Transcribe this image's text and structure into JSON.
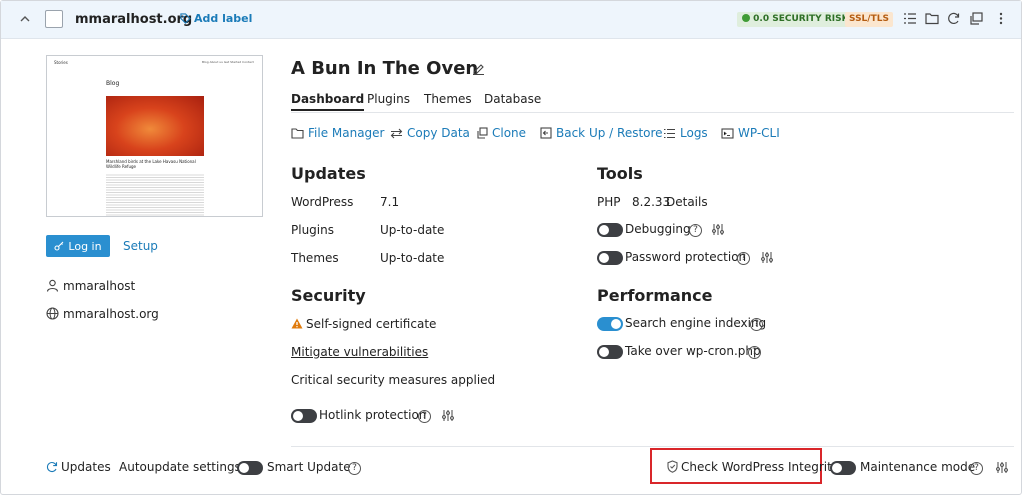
{
  "header": {
    "domain": "mmaralhost.org",
    "add_label": "Add label",
    "security_risk": "0.0 SECURITY RISK",
    "ssl_badge": "SSL/TLS"
  },
  "preview": {
    "site_name": "Stories",
    "nav": "Blog  About us  Get Started  Contact",
    "heading": "Blog",
    "post_title": "Marshland birds at the Lake Havasu National Wildlife Refuge",
    "login": "Log in",
    "setup": "Setup"
  },
  "owner": {
    "user": "mmaralhost",
    "site": "mmaralhost.org"
  },
  "site": {
    "title": "A Bun In The Oven"
  },
  "tabs": [
    {
      "label": "Dashboard"
    },
    {
      "label": "Plugins"
    },
    {
      "label": "Themes"
    },
    {
      "label": "Database"
    }
  ],
  "toolbar": [
    {
      "label": "File Manager"
    },
    {
      "label": "Copy Data"
    },
    {
      "label": "Clone"
    },
    {
      "label": "Back Up / Restore"
    },
    {
      "label": "Logs"
    },
    {
      "label": "WP-CLI"
    }
  ],
  "updates": {
    "title": "Updates",
    "rows": [
      {
        "name": "WordPress",
        "value": "7.1"
      },
      {
        "name": "Plugins",
        "value": "Up-to-date"
      },
      {
        "name": "Themes",
        "value": "Up-to-date"
      }
    ]
  },
  "security": {
    "title": "Security",
    "warning": "Self-signed certificate",
    "mitigate": "Mitigate vulnerabilities",
    "measures": "Critical security measures applied",
    "hotlink": "Hotlink protection"
  },
  "tools": {
    "title": "Tools",
    "php_label": "PHP",
    "php_version": "8.2.33",
    "php_details": "Details",
    "debugging": "Debugging",
    "password": "Password protection"
  },
  "performance": {
    "title": "Performance",
    "indexing": "Search engine indexing",
    "cron": "Take over wp-cron.php"
  },
  "footer": {
    "updates": "Updates",
    "autoupdate": "Autoupdate settings",
    "smart_update": "Smart Update",
    "integrity": "Check WordPress Integrity",
    "maintenance": "Maintenance mode"
  },
  "colors": {
    "accent": "#1b7bb8",
    "highlight_box": "#d9262a",
    "risk_green": "#3f9c35",
    "ssl_orange": "#d67a1e"
  },
  "icons": [
    "chevron-up-icon",
    "tag-icon",
    "list-icon",
    "folder-icon",
    "refresh-icon",
    "copy-icon",
    "more-icon",
    "login-icon",
    "user-icon",
    "globe-icon",
    "pencil-icon",
    "folder-icon",
    "copy-data-icon",
    "clone-icon",
    "backup-icon",
    "logs-icon",
    "terminal-icon",
    "warning-icon",
    "settings-sliders-icon",
    "shield-icon",
    "help-icon"
  ]
}
